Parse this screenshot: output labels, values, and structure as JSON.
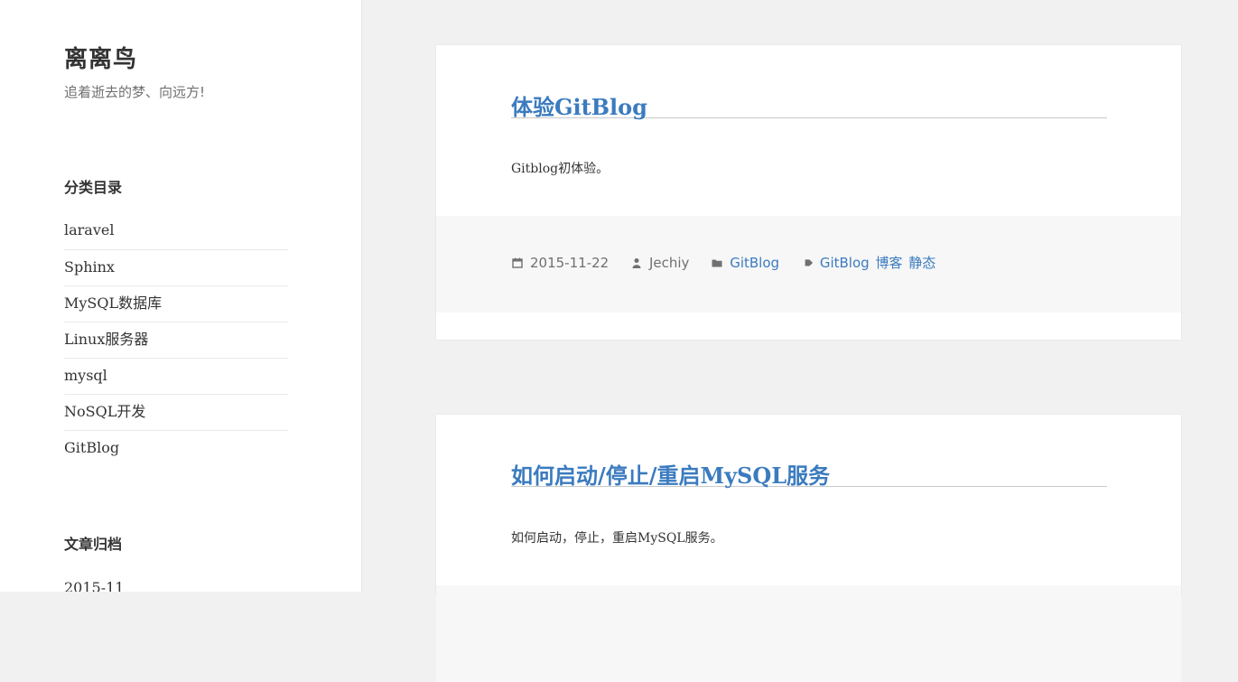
{
  "site": {
    "title": "离离鸟",
    "description": "追着逝去的梦、向远方!"
  },
  "sidebar": {
    "categories_title": "分类目录",
    "categories": [
      "laravel",
      "Sphinx",
      "MySQL数据库",
      "Linux服务器",
      "mysql",
      "NoSQL开发",
      "GitBlog"
    ],
    "archives_title": "文章归档",
    "archives": [
      "2015-11"
    ]
  },
  "posts": [
    {
      "title": "体验GitBlog",
      "excerpt": "Gitblog初体验。",
      "date": "2015-11-22",
      "author": "Jechiy",
      "category": "GitBlog",
      "tags": [
        "GitBlog",
        "博客",
        "静态"
      ]
    },
    {
      "title": "如何启动/停止/重启MySQL服务",
      "excerpt": "如何启动，停止，重启MySQL服务。"
    }
  ],
  "colors": {
    "link": "#3b7bbf",
    "text": "#333333",
    "muted": "#707070",
    "background": "#f1f1f1"
  },
  "icons": {
    "date": "calendar-icon",
    "author": "person-icon",
    "category": "folder-icon",
    "tags": "tag-icon"
  }
}
